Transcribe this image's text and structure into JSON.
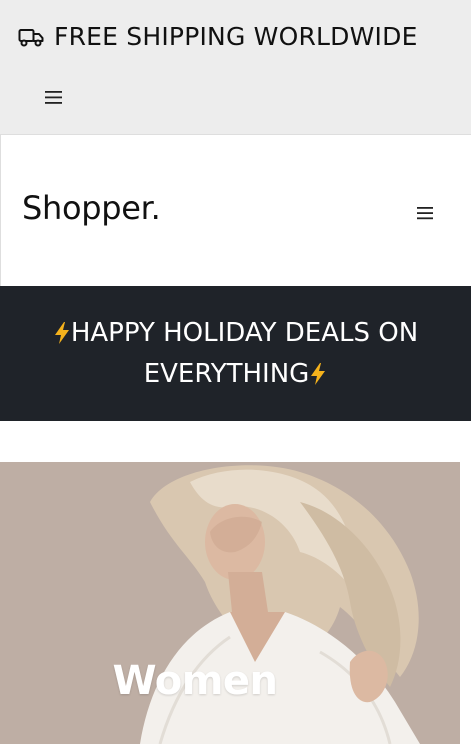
{
  "topbar": {
    "shipping_text": "FREE SHIPPING WORLDWIDE",
    "shipping_icon": "truck-icon",
    "menu_icon": "hamburger-menu-icon"
  },
  "navbar": {
    "brand": "Shopper.",
    "menu_icon": "hamburger-menu-icon"
  },
  "promo": {
    "line1": "HAPPY HOLIDAY DEALS ON",
    "line2": "EVERYTHING",
    "icon": "lightning-bolt-icon",
    "bolt_color": "#f5b21c",
    "background": "#1f2329"
  },
  "hero": {
    "label": "Women"
  }
}
